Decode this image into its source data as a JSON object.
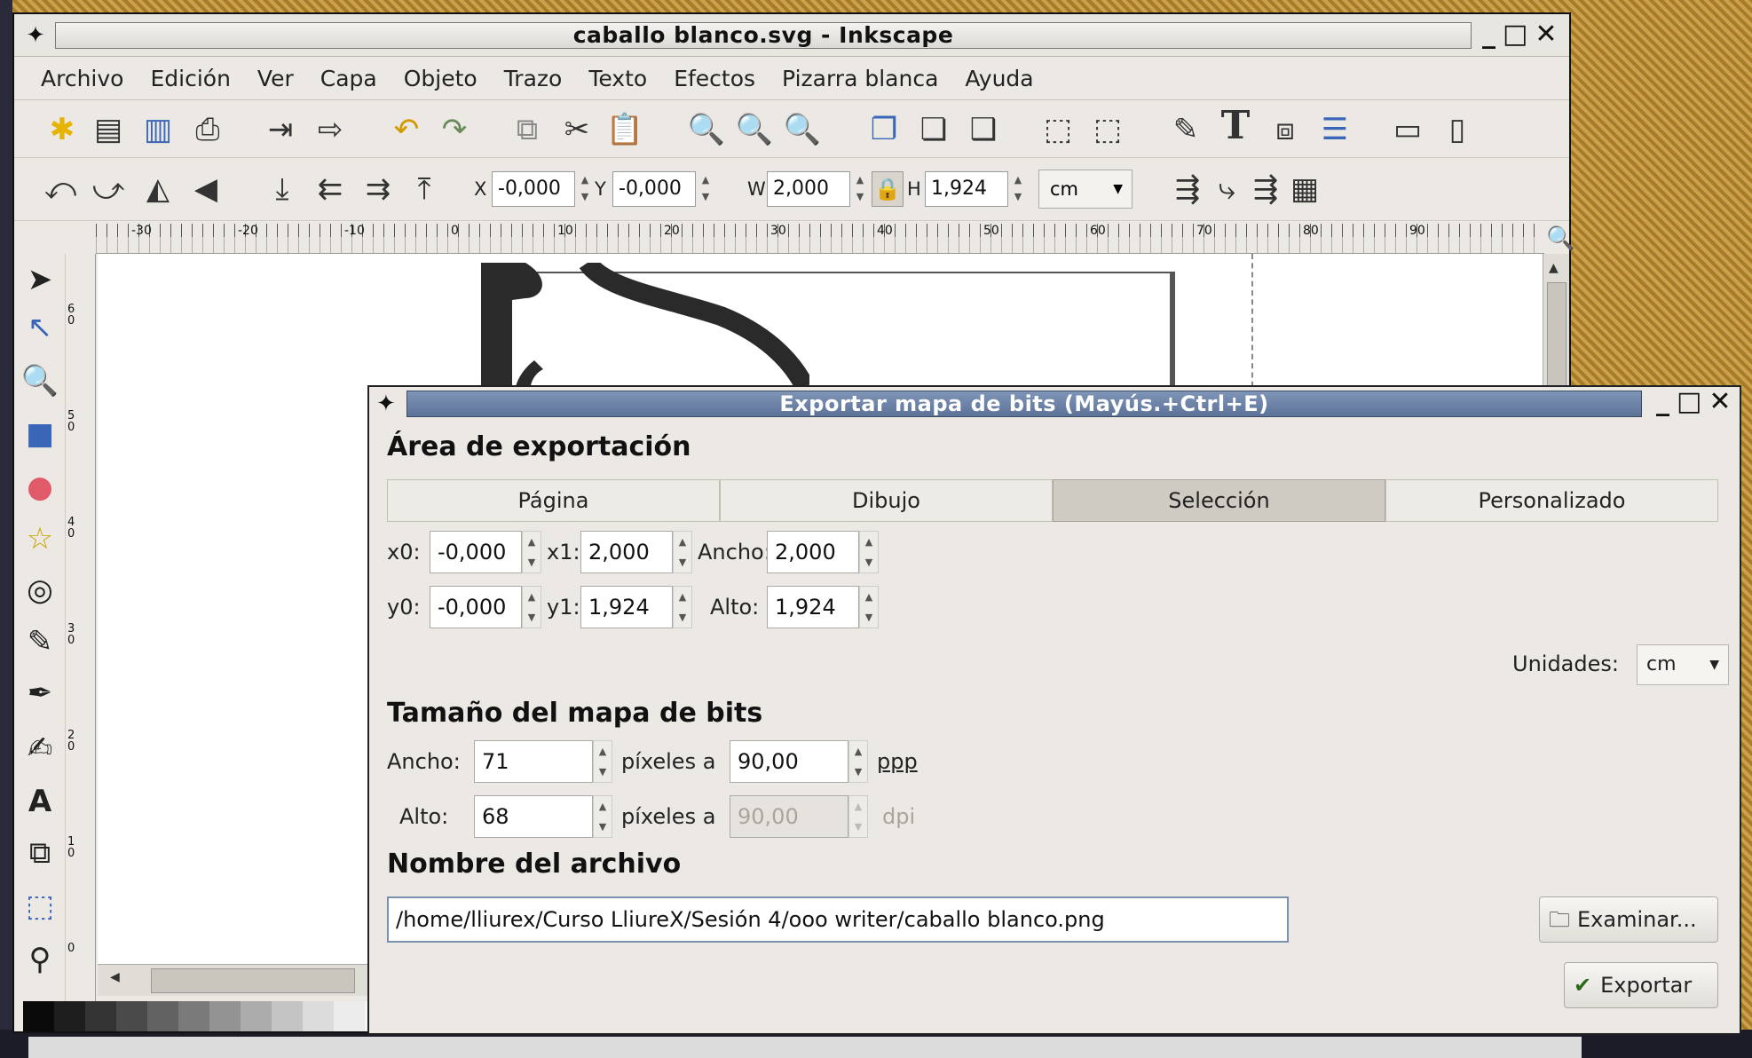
{
  "window": {
    "title": "caballo blanco.svg - Inkscape",
    "minimize": "_",
    "maximize": "□",
    "close": "✕"
  },
  "menu": [
    "Archivo",
    "Edición",
    "Ver",
    "Capa",
    "Objeto",
    "Trazo",
    "Texto",
    "Efectos",
    "Pizarra blanca",
    "Ayuda"
  ],
  "toolbar": {
    "x_label": "X",
    "x_value": "-0,000",
    "y_label": "Y",
    "y_value": "-0,000",
    "w_label": "W",
    "w_value": "2,000",
    "h_label": "H",
    "h_value": "1,924",
    "unit": "cm"
  },
  "ruler": {
    "h_labels": [
      "-30",
      "-20",
      "-10",
      "0",
      "10",
      "20",
      "30",
      "40",
      "50",
      "60",
      "70",
      "80",
      "90"
    ],
    "v_labels": [
      "6\n0",
      "5\n0",
      "4\n0",
      "3\n0",
      "2\n0",
      "1\n0",
      "0"
    ]
  },
  "palette": [
    "#0a0a0a",
    "#1e1e1e",
    "#333333",
    "#4a4a4a",
    "#626262",
    "#7a7a7a",
    "#939393",
    "#acacac",
    "#c4c4c4",
    "#dcdcdc",
    "#ececec",
    "#f6f6f6"
  ],
  "dialog": {
    "title": "Exportar mapa de bits (Mayús.+Ctrl+E)",
    "area_heading": "Área de exportación",
    "tabs": [
      "Página",
      "Dibujo",
      "Selección",
      "Personalizado"
    ],
    "active_tab": "Selección",
    "x0_label": "x0:",
    "x0": "-0,000",
    "x1_label": "x1:",
    "x1": "2,000",
    "ancho_label": "Ancho:",
    "ancho": "2,000",
    "y0_label": "y0:",
    "y0": "-0,000",
    "y1_label": "y1:",
    "y1": "1,924",
    "alto_label": "Alto:",
    "alto": "1,924",
    "units_label": "Unidades:",
    "units": "cm",
    "bitmap_heading": "Tamaño del mapa de bits",
    "bm_width_label": "Ancho:",
    "bm_width": "71",
    "bm_width_mid": "píxeles a",
    "bm_dpi": "90,00",
    "bm_dpi_unit": "ppp",
    "bm_height_label": "Alto:",
    "bm_height": "68",
    "bm_height_mid": "píxeles a",
    "bm_dpi2": "90,00",
    "bm_dpi2_unit": "dpi",
    "filename_heading": "Nombre del archivo",
    "filename": "/home/lliurex/Curso LliureX/Sesión 4/ooo writer/caballo blanco.png",
    "browse": "Examinar...",
    "export": "Exportar"
  }
}
